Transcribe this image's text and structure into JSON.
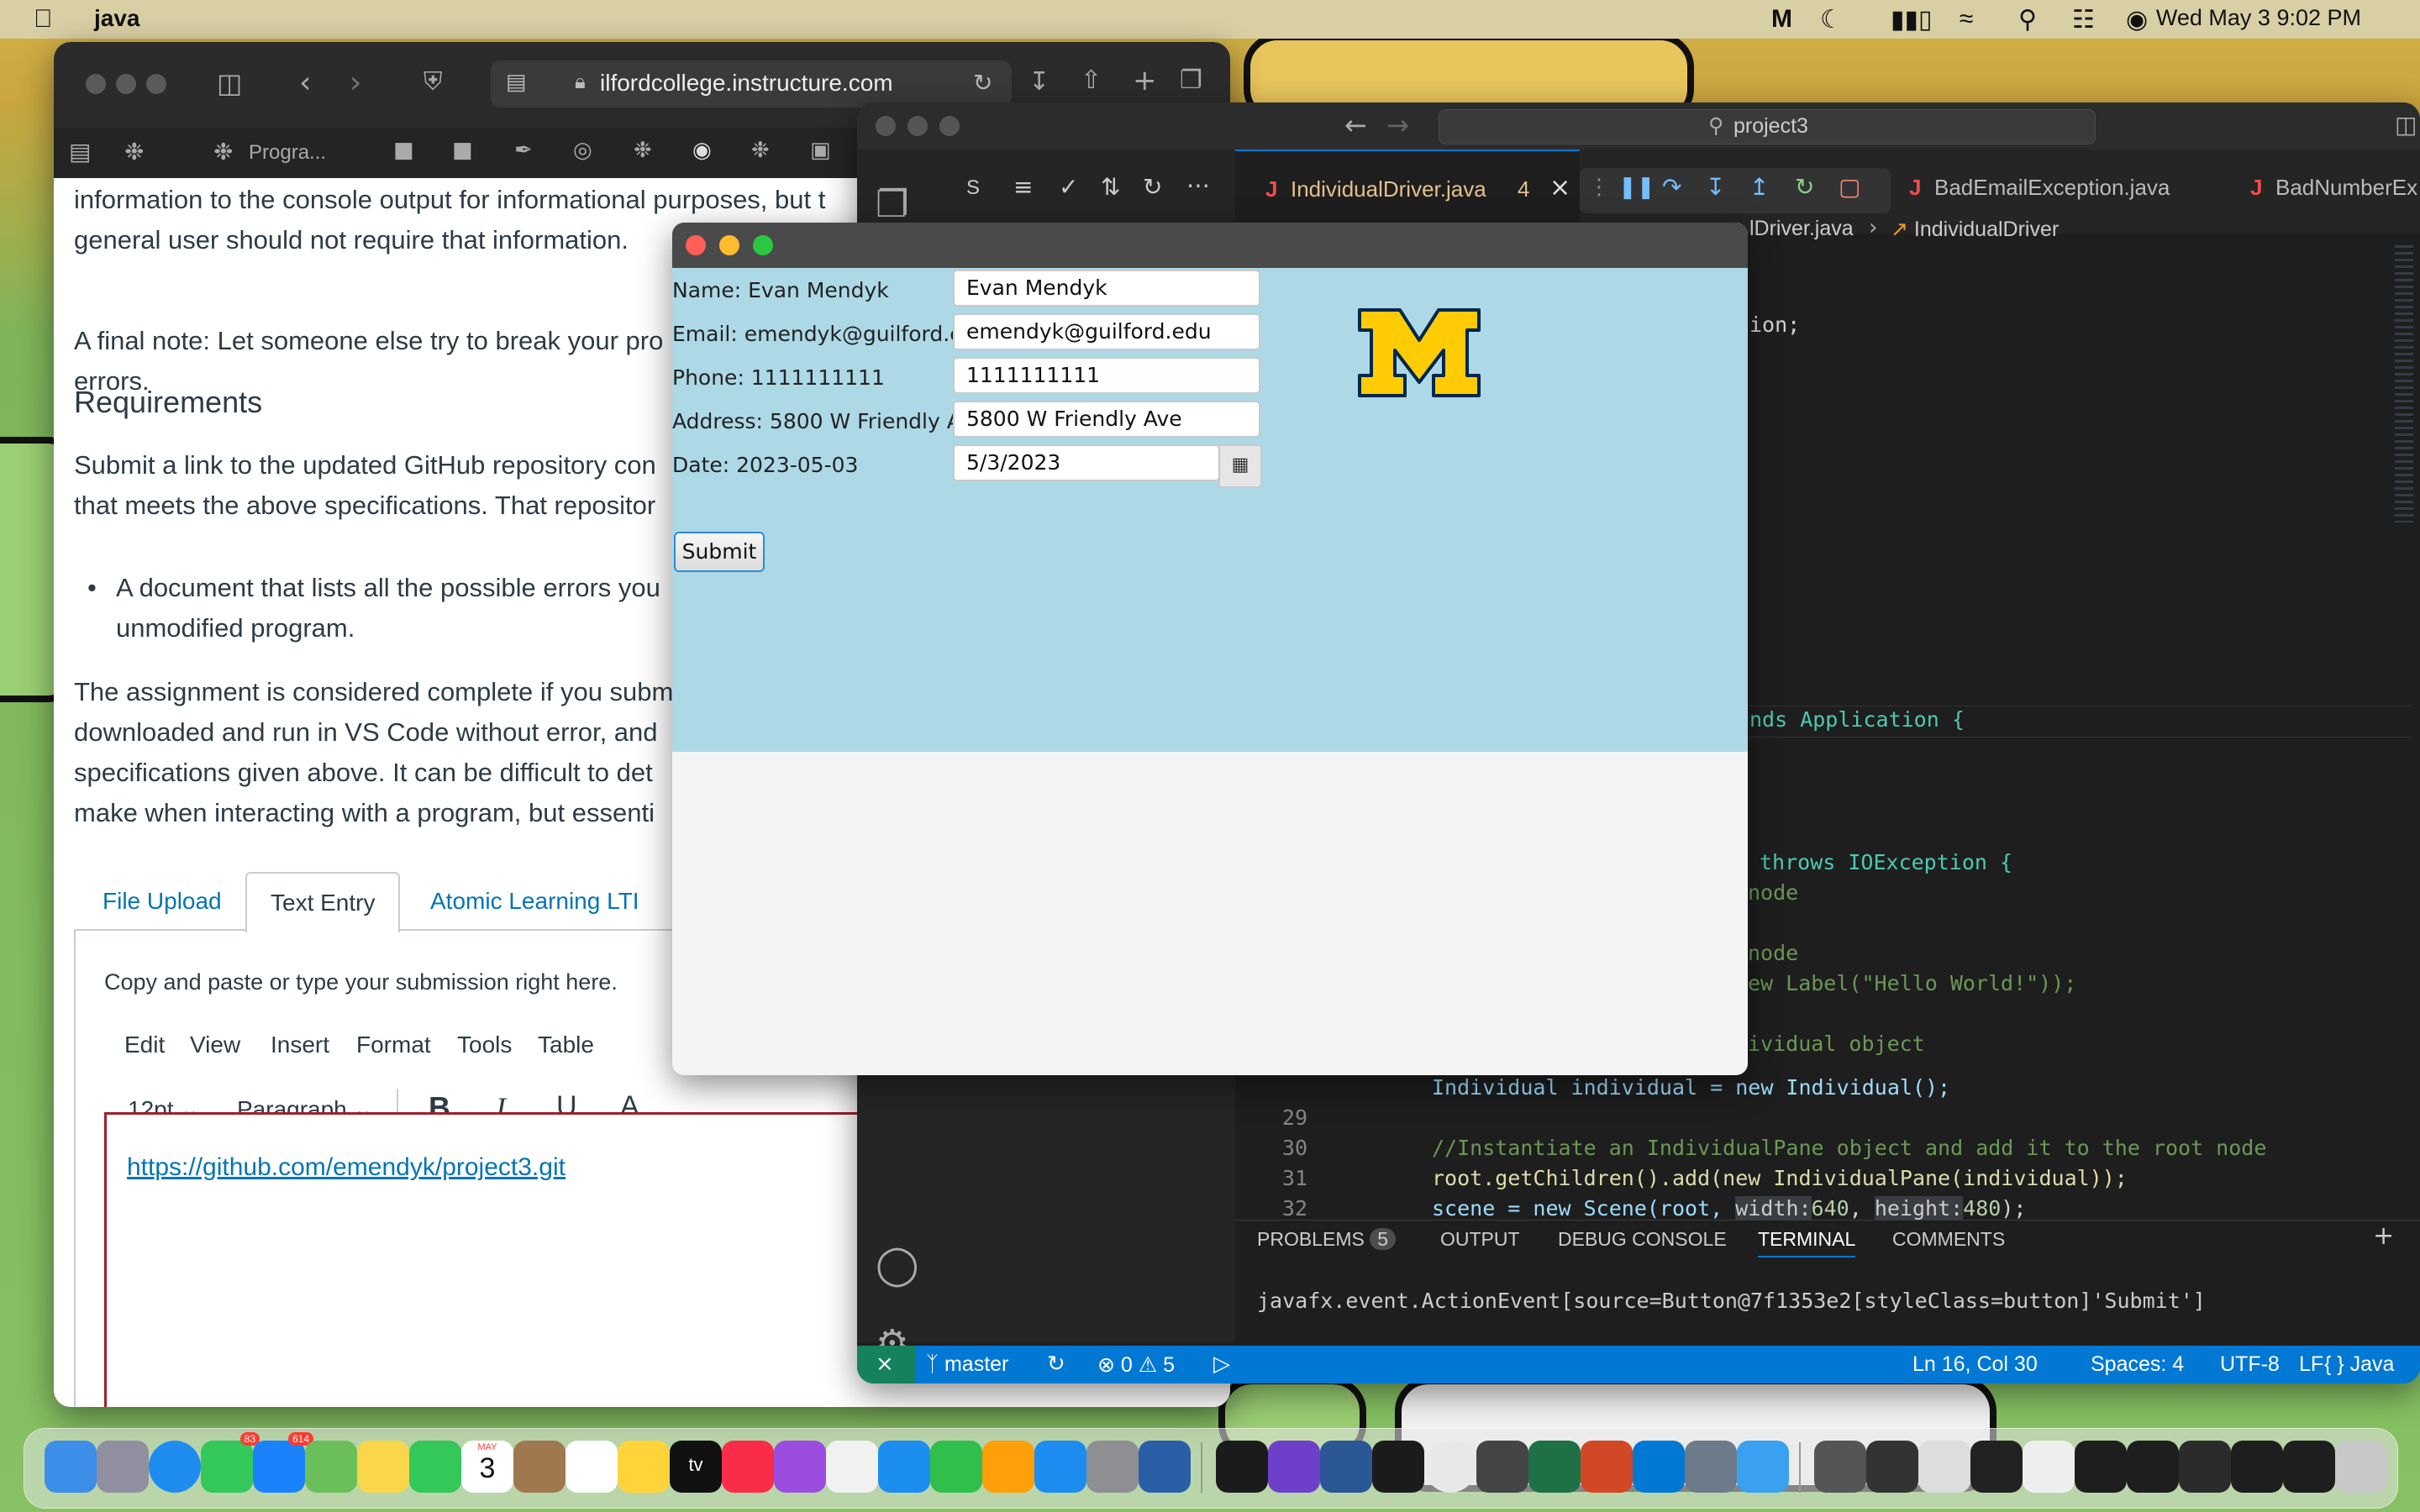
{
  "menubar": {
    "app_name": "java",
    "clock": "Wed May 3  9:02 PM"
  },
  "safari": {
    "url": "ilfordcollege.instructure.com",
    "tab_label": "Progra...",
    "content": {
      "para1_line1": "information to the console output for informational purposes, but t",
      "para1_line2": "general user should not require that information.",
      "para2_line1": "A final note: Let someone else try to break your pro",
      "para2_line2": "errors.",
      "heading": "Requirements",
      "para3_line1": "Submit a link to the updated GitHub repository con",
      "para3_line2": "that meets the above specifications. That repositor",
      "bullet_line1": "A document that lists all the possible errors you",
      "bullet_line2": "unmodified program.",
      "para4_line1": "The assignment is considered complete if you subm",
      "para4_line2": "downloaded and run in VS Code without error, and",
      "para4_line3": "specifications given above. It can be difficult to det",
      "para4_line4": "make when interacting with a program, but essenti"
    },
    "submission_tabs": [
      "File Upload",
      "Text Entry",
      "Atomic Learning LTI"
    ],
    "submission_hint": "Copy and paste or type your submission right here.",
    "editor_menu": [
      "Edit",
      "View",
      "Insert",
      "Format",
      "Tools",
      "Table"
    ],
    "font_size": "12pt",
    "paragraph_style": "Paragraph",
    "editor_link": "https://github.com/emendyk/project3.git"
  },
  "vscode": {
    "search_text": "project3",
    "explorer_letter": "S",
    "tabs": [
      {
        "label": "IndividualDriver.java",
        "badge": "4"
      },
      {
        "label": "BadEmailException.java"
      },
      {
        "label": "BadNumberEx"
      }
    ],
    "breadcrumb_file": "lDriver.java",
    "breadcrumb_class": "IndividualDriver",
    "code_fragments": {
      "ion": "ion;",
      "extends": "nds Application {",
      "throws": "throws IOException {",
      "node1": "node",
      "node2": "node",
      "label": "ew Label(\"Hello World!\"));",
      "individual_comment": "ividual object",
      "line28": "Individual individual = new Individual();",
      "line30": "//Instantiate an IndividualPane object and add it to the root node",
      "line31": "root.getChildren().add(new IndividualPane(individual));",
      "line32_a": "scene = new Scene(root, ",
      "line32_w": "width:",
      "line32_wv": "640",
      "line32_h": "height:",
      "line32_hv": "480",
      "line32_end": ");"
    },
    "line_numbers": [
      "28",
      "29",
      "30",
      "31",
      "32"
    ],
    "panel_tabs": [
      "PROBLEMS",
      "OUTPUT",
      "DEBUG CONSOLE",
      "TERMINAL",
      "COMMENTS"
    ],
    "problems_count": "5",
    "terminal_output": "javafx.event.ActionEvent[source=Button@7f1353e2[styleClass=button]'Submit']",
    "status": {
      "branch": "master",
      "errors": "0",
      "warnings": "5",
      "position": "Ln 16, Col 30",
      "spaces": "Spaces: 4",
      "encoding": "UTF-8",
      "eol": "LF",
      "language": "Java",
      "lang_braces": "{ }"
    }
  },
  "fx_app": {
    "name_label": "Name: Evan Mendyk",
    "name_value": "Evan Mendyk",
    "email_label": "Email: emendyk@guilford.edu",
    "email_value": "emendyk@guilford.edu",
    "phone_label": "Phone: 1111111111",
    "phone_value": "1111111111",
    "address_label": "Address: 5800 W Friendly Ave",
    "address_value": "5800 W Friendly Ave",
    "date_label": "Date: 2023-05-03",
    "date_value": "5/3/2023",
    "submit_label": "Submit",
    "logo_letter": "M"
  },
  "dock": {
    "calendar_month": "MAY",
    "calendar_day": "3",
    "messages_badge": "83",
    "mail_badge": "614",
    "tv_label": "tv"
  },
  "colors": {
    "fx_form_bg": "#add8e6",
    "logo_maize": "#ffcb05",
    "logo_blue": "#00274c",
    "vscode_status": "#0078d4",
    "canvas_link": "#0374b5"
  }
}
